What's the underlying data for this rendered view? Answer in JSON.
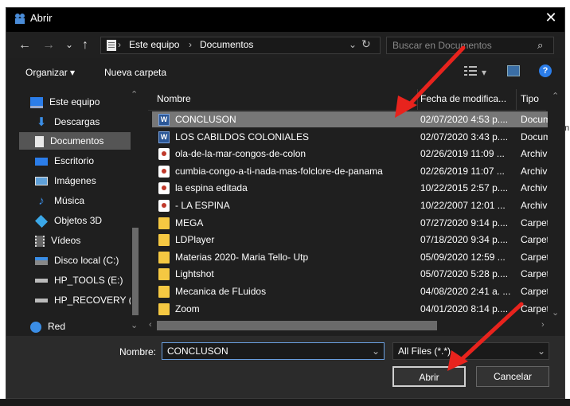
{
  "window": {
    "title": "Abrir",
    "close_glyph": "✕"
  },
  "nav": {
    "back": "←",
    "forward": "→",
    "recent": "⌄",
    "up": "↑",
    "path": [
      "Este equipo",
      "Documentos"
    ],
    "path_sep": "›",
    "addr_dropdown": "⌄",
    "refresh": "↻",
    "search_placeholder": "Buscar en Documentos",
    "search_glyph": "⌕"
  },
  "toolbar": {
    "organize": "Organizar ▾",
    "new_folder": "Nueva carpeta",
    "view_dropdown": "▾",
    "help": "?"
  },
  "sidebar": {
    "items": [
      {
        "label": "Este equipo",
        "icon": "computer-icon"
      },
      {
        "label": "Descargas",
        "icon": "download-icon"
      },
      {
        "label": "Documentos",
        "icon": "document-icon"
      },
      {
        "label": "Escritorio",
        "icon": "desktop-icon"
      },
      {
        "label": "Imágenes",
        "icon": "pictures-icon"
      },
      {
        "label": "Música",
        "icon": "music-icon"
      },
      {
        "label": "Objetos 3D",
        "icon": "cube-icon"
      },
      {
        "label": "Vídeos",
        "icon": "video-icon"
      },
      {
        "label": "Disco local (C:)",
        "icon": "drive-icon"
      },
      {
        "label": "HP_TOOLS (E:)",
        "icon": "drive-icon"
      },
      {
        "label": "HP_RECOVERY (",
        "icon": "drive-icon"
      },
      {
        "label": "Red",
        "icon": "network-icon"
      }
    ],
    "selected": "Documentos"
  },
  "columns": {
    "name": "Nombre",
    "date": "Fecha de modifica...",
    "type": "Tipo"
  },
  "files": [
    {
      "name": "CONCLUSON",
      "date": "02/07/2020 4:53 p....",
      "type": "Docum",
      "kind": "word"
    },
    {
      "name": "LOS CABILDOS COLONIALES",
      "date": "02/07/2020 3:43 p....",
      "type": "Docum",
      "kind": "word"
    },
    {
      "name": "ola-de-la-mar-congos-de-colon",
      "date": "02/26/2019 11:09 ...",
      "type": "Archiv",
      "kind": "media"
    },
    {
      "name": "cumbia-congo-a-ti-nada-mas-folclore-de-panama",
      "date": "02/26/2019 11:07 ...",
      "type": "Archiv",
      "kind": "media"
    },
    {
      "name": "la espina editada",
      "date": "10/22/2015 2:57 p....",
      "type": "Archiv",
      "kind": "media"
    },
    {
      "name": "- LA ESPINA",
      "date": "10/22/2007 12:01 ...",
      "type": "Archiv",
      "kind": "media"
    },
    {
      "name": "MEGA",
      "date": "07/27/2020 9:14 p....",
      "type": "Carpet",
      "kind": "folder"
    },
    {
      "name": "LDPlayer",
      "date": "07/18/2020 9:34 p....",
      "type": "Carpet",
      "kind": "folder"
    },
    {
      "name": "Materias 2020- Maria Tello- Utp",
      "date": "05/09/2020 12:59 ...",
      "type": "Carpet",
      "kind": "folder"
    },
    {
      "name": "Lightshot",
      "date": "05/07/2020 5:28 p....",
      "type": "Carpet",
      "kind": "folder"
    },
    {
      "name": "Mecanica de FLuidos",
      "date": "04/08/2020 2:41 a. ...",
      "type": "Carpet",
      "kind": "folder"
    },
    {
      "name": "Zoom",
      "date": "04/01/2020 8:14 p....",
      "type": "Carpet",
      "kind": "folder"
    }
  ],
  "selected_file": "CONCLUSON",
  "footer": {
    "name_label": "Nombre:",
    "name_value": "CONCLUSON",
    "filter_value": "All Files (*.*)",
    "dropdown": "⌄",
    "open": "Abrir",
    "cancel": "Cancelar"
  },
  "side_edge_text": "m",
  "colors": {
    "annotation_arrow": "#e8231d",
    "selection": "#777777",
    "accent": "#2b7de9"
  }
}
